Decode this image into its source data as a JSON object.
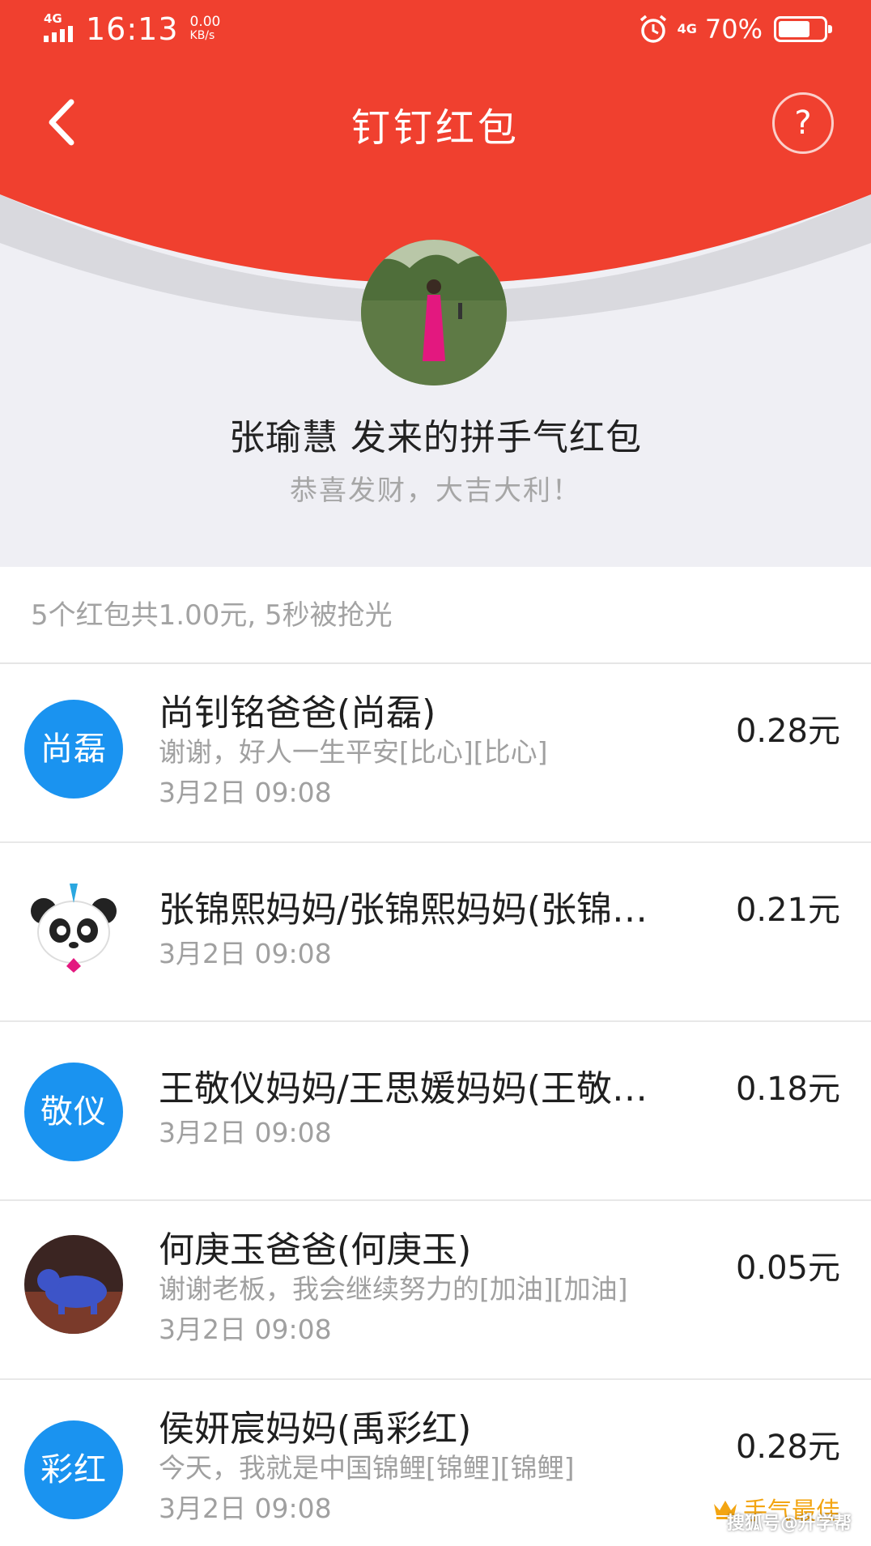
{
  "status_bar": {
    "network": "4G",
    "time": "16:13",
    "speed_value": "0.00",
    "speed_unit": "KB/s",
    "network_right": "4G",
    "battery_percent": "70%",
    "battery_level": 0.7
  },
  "header": {
    "title": "钉钉红包",
    "help_label": "?"
  },
  "sender": {
    "title": "张瑜慧 发来的拼手气红包",
    "greeting": "恭喜发财，大吉大利！"
  },
  "summary": "5个红包共1.00元, 5秒被抢光",
  "recipients": [
    {
      "avatar_text": "尚磊",
      "name": "尚钊铭爸爸(尚磊)",
      "message": "谢谢，好人一生平安[比心][比心]",
      "time": "3月2日 09:08",
      "amount": "0.28元"
    },
    {
      "avatar_text": "",
      "name": "张锦熙妈妈/张锦熙妈妈(张锦…",
      "message": "",
      "time": "3月2日 09:08",
      "amount": "0.21元"
    },
    {
      "avatar_text": "敬仪",
      "name": "王敬仪妈妈/王思媛妈妈(王敬…",
      "message": "",
      "time": "3月2日 09:08",
      "amount": "0.18元"
    },
    {
      "avatar_text": "",
      "name": "何庚玉爸爸(何庚玉)",
      "message": "谢谢老板，我会继续努力的[加油][加油]",
      "time": "3月2日 09:08",
      "amount": "0.05元"
    },
    {
      "avatar_text": "彩红",
      "name": "侯妍宸妈妈(禹彩红)",
      "message": "今天，我就是中国锦鲤[锦鲤][锦鲤]",
      "time": "3月2日 09:08",
      "amount": "0.28元",
      "badge": "手气最佳"
    }
  ],
  "watermark": "搜狐号@升学帮",
  "colors": {
    "header_red": "#f0402f",
    "avatar_blue": "#1a93f0",
    "best_gold": "#f3a512"
  },
  "icons": [
    "back-arrow-icon",
    "help-icon",
    "alarm-icon",
    "signal-icon",
    "battery-icon",
    "crown-icon"
  ]
}
